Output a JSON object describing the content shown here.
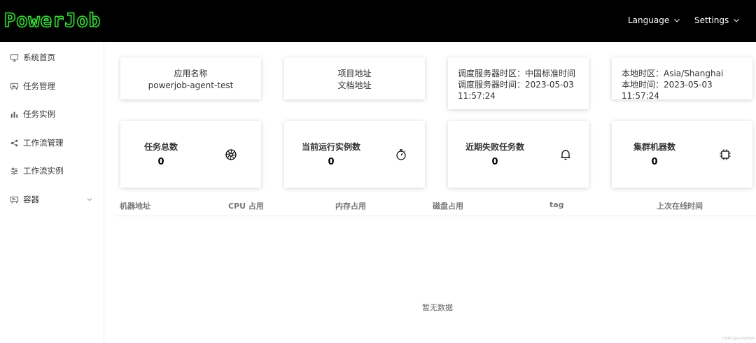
{
  "header": {
    "logo": "PowerJob",
    "language": "Language",
    "settings": "Settings"
  },
  "sidebar": {
    "items": [
      {
        "label": "系统首页",
        "icon": "desktop-icon"
      },
      {
        "label": "任务管理",
        "icon": "task-board-icon"
      },
      {
        "label": "任务实例",
        "icon": "bar-chart-icon"
      },
      {
        "label": "工作流管理",
        "icon": "share-icon"
      },
      {
        "label": "工作流实例",
        "icon": "sliders-icon"
      },
      {
        "label": "容器",
        "icon": "container-icon"
      }
    ]
  },
  "info_cards": {
    "app": {
      "line1": "应用名称",
      "line2": "powerjob-agent-test"
    },
    "links": {
      "line1": "项目地址",
      "line2": "文档地址"
    },
    "server": {
      "line1": "调度服务器时区：中国标准时间",
      "line2": "调度服务器时间：2023-05-03",
      "line3": "11:57:24"
    },
    "local": {
      "line1": "本地时区：Asia/Shanghai",
      "line2": "本地时间：2023-05-03 11:57:24"
    }
  },
  "stats": [
    {
      "label": "任务总数",
      "value": "0",
      "icon": "aperture-icon"
    },
    {
      "label": "当前运行实例数",
      "value": "0",
      "icon": "stopwatch-icon"
    },
    {
      "label": "近期失败任务数",
      "value": "0",
      "icon": "bell-icon"
    },
    {
      "label": "集群机器数",
      "value": "0",
      "icon": "cpu-chip-icon"
    }
  ],
  "table": {
    "columns": [
      "机器地址",
      "CPU 占用",
      "内存占用",
      "磁盘占用",
      "tag",
      "上次在线时间"
    ],
    "empty_text": "暂无数据"
  },
  "watermark": "CSDN @xuzhi0505"
}
